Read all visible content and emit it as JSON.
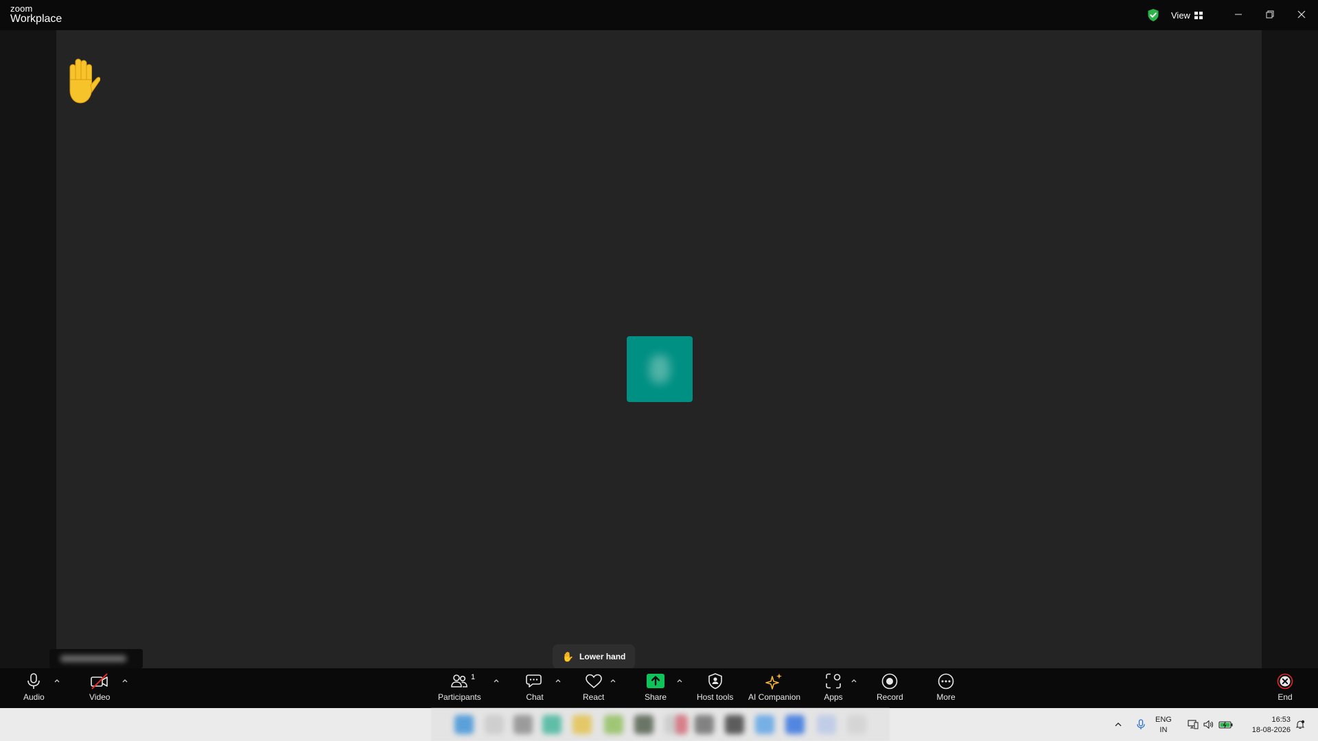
{
  "window": {
    "logo_top": "zoom",
    "logo_bottom": "Workplace",
    "view_label": "View",
    "security_color": "#2cb34a"
  },
  "stage": {
    "raised_hand": "✋",
    "avatar_color": "#008f83"
  },
  "lower_hand": {
    "label": "Lower hand",
    "icon": "✋"
  },
  "toolbar": {
    "audio": "Audio",
    "video": "Video",
    "participants": "Participants",
    "participants_count": "1",
    "chat": "Chat",
    "react": "React",
    "share": "Share",
    "host_tools": "Host tools",
    "ai_companion": "AI Companion",
    "apps": "Apps",
    "record": "Record",
    "more": "More",
    "end": "End",
    "share_color": "#0ec45a",
    "end_color": "#e02828",
    "ai_color": "#f4b53a"
  },
  "taskbar": {
    "lang_line1": "ENG",
    "lang_line2": "IN",
    "time": "16:53",
    "date": "18-08-2026"
  }
}
